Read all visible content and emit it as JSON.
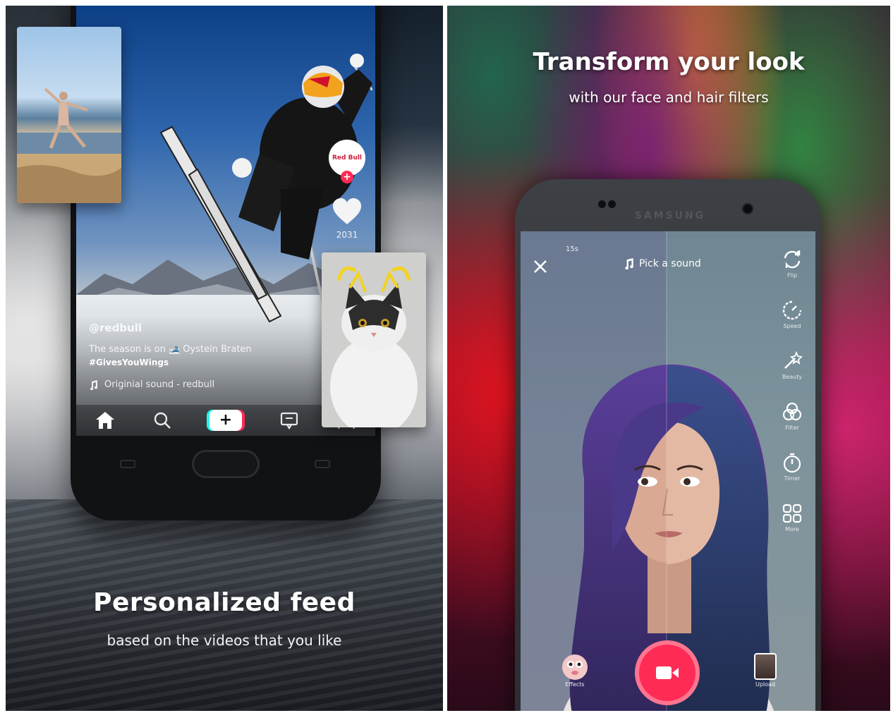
{
  "left_panel": {
    "headline": "Personalized feed",
    "subhead": "based on the videos that you like",
    "feed": {
      "username": "@redbull",
      "description": "The season is on 🎿 Oystein Braten",
      "hashtag": "#GivesYouWings",
      "sound": "Originial sound - redbull",
      "like_count": "2031",
      "avatar_text": "Red Bull"
    },
    "nav": {
      "home": "home-icon",
      "discover": "search-icon",
      "create": "+",
      "inbox": "inbox-icon",
      "profile": "profile-icon"
    }
  },
  "right_panel": {
    "headline": "Transform your look",
    "subhead": "with our face and hair filters",
    "phone_brand": "SAMSUNG",
    "camera": {
      "duration": "15s",
      "pick_sound": "Pick a sound",
      "tools": [
        {
          "label": "Flip",
          "icon": "flip-icon"
        },
        {
          "label": "Speed",
          "icon": "speed-icon"
        },
        {
          "label": "Beauty",
          "icon": "beauty-wand-icon"
        },
        {
          "label": "Filter",
          "icon": "filter-icon"
        },
        {
          "label": "Timer",
          "icon": "timer-icon"
        },
        {
          "label": "More",
          "icon": "more-grid-icon"
        }
      ],
      "effects_label": "Effects",
      "upload_label": "Upload"
    }
  },
  "colors": {
    "accent_red": "#fe2c55",
    "accent_cyan": "#25f4ee"
  }
}
